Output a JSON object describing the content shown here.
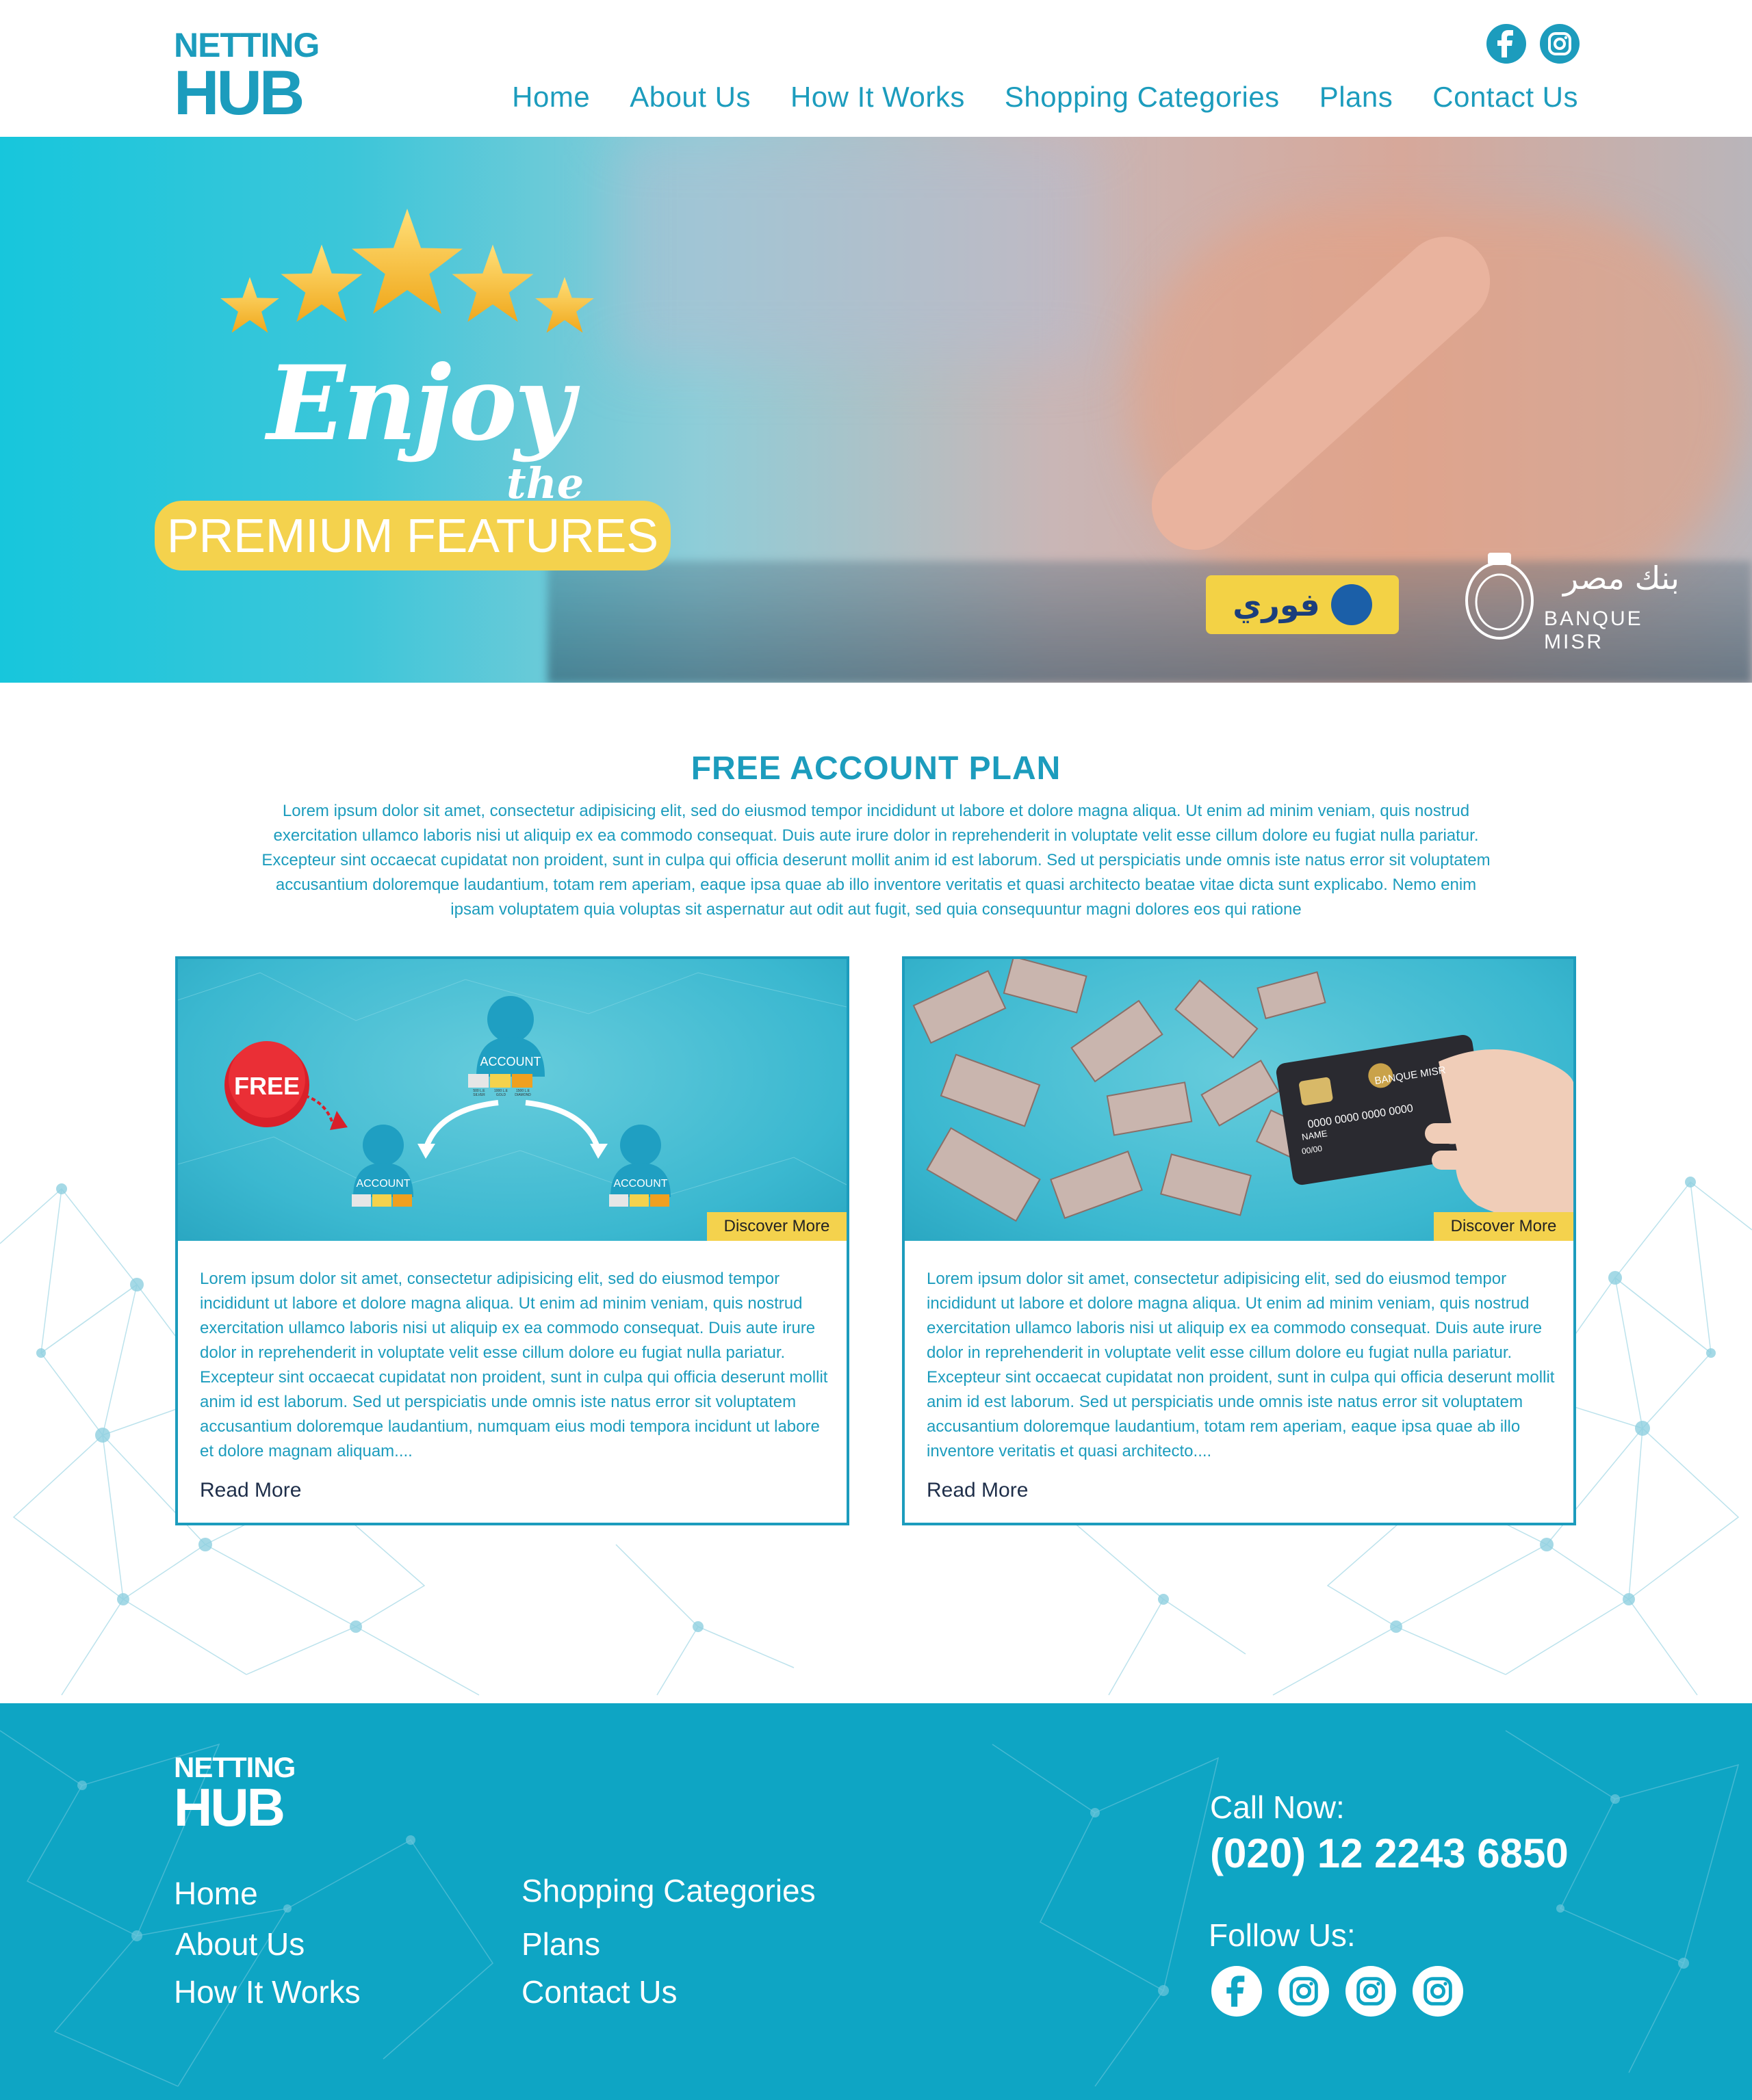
{
  "header": {
    "logo": {
      "line1": "NETTING",
      "line2": "HUB"
    },
    "social": [
      {
        "icon": "facebook-icon"
      },
      {
        "icon": "instagram-icon"
      }
    ],
    "nav": [
      "Home",
      "About Us",
      "How It Works",
      "Shopping Categories",
      "Plans",
      "Contact Us"
    ]
  },
  "hero": {
    "headline": "Enjoy",
    "connector": "the",
    "badge": "PREMIUM FEATURES",
    "partners": {
      "fawry": "فوري",
      "banque_arabic": "بنك مصر",
      "banque_name": "BANQUE MISR"
    }
  },
  "section": {
    "title": "FREE ACCOUNT PLAN",
    "intro": "Lorem ipsum dolor sit amet, consectetur adipisicing elit, sed do eiusmod tempor incididunt ut labore et dolore magna aliqua. Ut enim ad minim veniam, quis nostrud exercitation ullamco laboris nisi ut aliquip ex ea commodo consequat. Duis aute irure dolor in reprehenderit in voluptate velit esse cillum dolore eu fugiat nulla pariatur. Excepteur sint occaecat cupidatat non proident, sunt in culpa qui officia deserunt mollit anim id est laborum. Sed ut perspiciatis unde omnis iste natus error sit voluptatem accusantium doloremque laudantium, totam rem aperiam, eaque ipsa quae ab illo inventore veritatis et quasi architecto beatae vitae dicta sunt explicabo. Nemo enim ipsam voluptatem quia voluptas sit aspernatur aut odit aut fugit, sed quia consequuntur magni dolores eos qui ratione"
  },
  "cards": [
    {
      "discover": "Discover More",
      "free_label": "FREE",
      "account_label": "ACCOUNT",
      "tiers": [
        "500 L.E SILVER",
        "1000 L.E GOLD",
        "1500 L.E DIAMOND"
      ],
      "text": "Lorem ipsum dolor sit amet, consectetur adipisicing elit, sed do eiusmod tempor incididunt ut labore et dolore magna aliqua. Ut enim ad minim veniam, quis nostrud exercitation ullamco laboris nisi ut aliquip ex ea commodo consequat. Duis aute irure dolor in reprehenderit in voluptate velit esse cillum dolore eu fugiat nulla pariatur. Excepteur sint occaecat cupidatat non proident, sunt in culpa qui officia deserunt mollit anim id est laborum. Sed ut perspiciatis unde omnis iste natus error sit voluptatem accusantium doloremque laudantium, numquam eius modi tempora incidunt ut labore et dolore magnam aliquam....",
      "read_more": "Read More"
    },
    {
      "discover": "Discover More",
      "card_bank": "BANQUE MISR",
      "card_number": "0000 0000 0000 0000",
      "card_name": "NAME",
      "card_expiry": "00/00",
      "text": "Lorem ipsum dolor sit amet, consectetur adipisicing elit, sed do eiusmod tempor incididunt ut labore et dolore magna aliqua. Ut enim ad minim veniam, quis nostrud exercitation ullamco laboris nisi ut aliquip ex ea commodo consequat. Duis aute irure dolor in reprehenderit in voluptate velit esse cillum dolore eu fugiat nulla pariatur. Excepteur sint occaecat cupidatat non proident, sunt in culpa qui officia deserunt mollit anim id est laborum. Sed ut perspiciatis unde omnis iste natus error sit voluptatem accusantium doloremque laudantium, totam rem aperiam, eaque ipsa quae ab illo inventore veritatis et quasi architecto....",
      "read_more": "Read More"
    }
  ],
  "footer": {
    "logo": {
      "line1": "NETTING",
      "line2": "HUB"
    },
    "links_col1": [
      "Home",
      "About Us",
      "How It Works"
    ],
    "links_col2": [
      "Shopping Categories",
      "Plans",
      "Contact Us"
    ],
    "call_label": "Call Now:",
    "phone": "(020) 12 2243 6850",
    "follow_label": "Follow Us:",
    "social": [
      {
        "icon": "facebook-icon"
      },
      {
        "icon": "instagram-icon"
      },
      {
        "icon": "instagram-icon"
      },
      {
        "icon": "instagram-icon"
      }
    ]
  },
  "colors": {
    "brand": "#1c9cbd",
    "accent": "#f4d24d",
    "footer_bg": "#0ea5c4",
    "text_dark": "#1f2f4a"
  }
}
